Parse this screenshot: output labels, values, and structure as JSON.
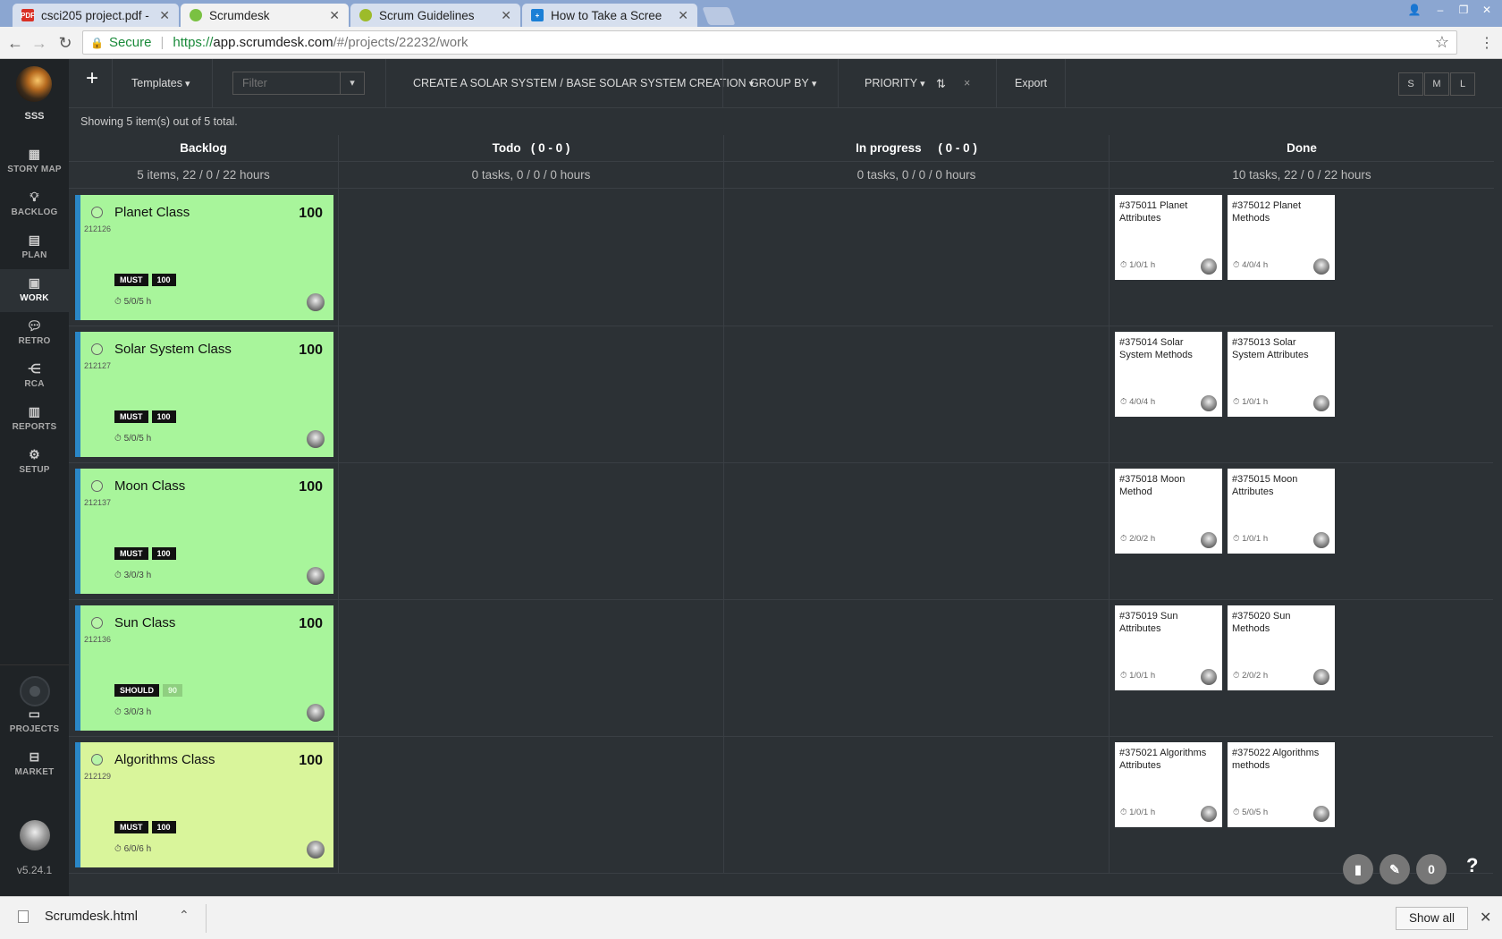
{
  "browser": {
    "tabs": [
      {
        "label": "csci205 project.pdf -",
        "favicon": "PDF",
        "color": "#d93025"
      },
      {
        "label": "Scrumdesk",
        "favicon": "",
        "color": "#7ac142"
      },
      {
        "label": "Scrum Guidelines",
        "favicon": "",
        "color": "#9dbb2a"
      },
      {
        "label": "How to Take a Scree",
        "favicon": "+",
        "color": "#1a7fd6"
      }
    ],
    "secure_label": "Secure",
    "url_scheme": "https://",
    "url_host": "app.scrumdesk.com",
    "url_path": "/#/projects/22232/work"
  },
  "sidebar": {
    "project": "SSS",
    "items": [
      {
        "label": "STORY MAP",
        "icon": "grid-icon"
      },
      {
        "label": "BACKLOG",
        "icon": "lightbulb-icon"
      },
      {
        "label": "PLAN",
        "icon": "list-icon"
      },
      {
        "label": "WORK",
        "icon": "briefcase-icon"
      },
      {
        "label": "RETRO",
        "icon": "comment-icon"
      },
      {
        "label": "RCA",
        "icon": "share-icon"
      },
      {
        "label": "REPORTS",
        "icon": "bar-chart-icon"
      },
      {
        "label": "SETUP",
        "icon": "gear-icon"
      },
      {
        "label": "PROJECTS",
        "icon": "folder-icon"
      },
      {
        "label": "MARKET",
        "icon": "bag-icon"
      }
    ],
    "version": "v5.24.1"
  },
  "toolbar": {
    "templates": "Templates",
    "filter_placeholder": "Filter",
    "breadcrumb": "CREATE A SOLAR SYSTEM / BASE SOLAR SYSTEM CREATION",
    "group_by": "GROUP BY",
    "priority": "PRIORITY",
    "clear": "×",
    "export": "Export",
    "sizes": [
      "S",
      "M",
      "L"
    ]
  },
  "board": {
    "showing": "Showing 5 item(s) out of 5 total.",
    "columns": [
      {
        "title": "Backlog",
        "summary": "5 items, 22 / 0 / 22 hours"
      },
      {
        "title": "Todo   ( 0 - 0 )",
        "summary": "0 tasks, 0 / 0 / 0 hours"
      },
      {
        "title": "In progress     ( 0 - 0 )",
        "summary": "0 tasks, 0 / 0 / 0 hours"
      },
      {
        "title": "Done",
        "summary": "10 tasks, 22 / 0 / 22 hours"
      }
    ],
    "stories": [
      {
        "name": "Planet Class",
        "id": "212126",
        "priority": "100",
        "moscow": "MUST",
        "value": "100",
        "time": "5/0/5 h",
        "tasks": [
          {
            "title": "#375011 Planet Attributes",
            "time": "1/0/1 h"
          },
          {
            "title": "#375012 Planet Methods",
            "time": "4/0/4 h"
          }
        ]
      },
      {
        "name": "Solar System Class",
        "id": "212127",
        "priority": "100",
        "moscow": "MUST",
        "value": "100",
        "time": "5/0/5 h",
        "tasks": [
          {
            "title": "#375014 Solar System Methods",
            "time": "4/0/4 h"
          },
          {
            "title": "#375013 Solar System Attributes",
            "time": "1/0/1 h"
          }
        ]
      },
      {
        "name": "Moon Class",
        "id": "212137",
        "priority": "100",
        "moscow": "MUST",
        "value": "100",
        "time": "3/0/3 h",
        "tasks": [
          {
            "title": "#375018 Moon Method",
            "time": "2/0/2 h"
          },
          {
            "title": "#375015 Moon Attributes",
            "time": "1/0/1 h"
          }
        ]
      },
      {
        "name": "Sun Class",
        "id": "212136",
        "priority": "100",
        "moscow": "SHOULD",
        "value": "90",
        "time": "3/0/3 h",
        "tasks": [
          {
            "title": "#375019 Sun Attributes",
            "time": "1/0/1 h"
          },
          {
            "title": "#375020 Sun Methods",
            "time": "2/0/2 h"
          }
        ]
      },
      {
        "name": "Algorithms Class",
        "id": "212129",
        "priority": "100",
        "moscow": "MUST",
        "value": "100",
        "time": "6/0/6 h",
        "tasks": [
          {
            "title": "#375021 Algorithms Attributes",
            "time": "1/0/1 h"
          },
          {
            "title": "#375022 Algorithms methods",
            "time": "5/0/5 h"
          }
        ]
      }
    ]
  },
  "fab": {
    "counter": "0",
    "help": "?"
  },
  "downloads": {
    "file": "Scrumdesk.html",
    "show_all": "Show all"
  }
}
